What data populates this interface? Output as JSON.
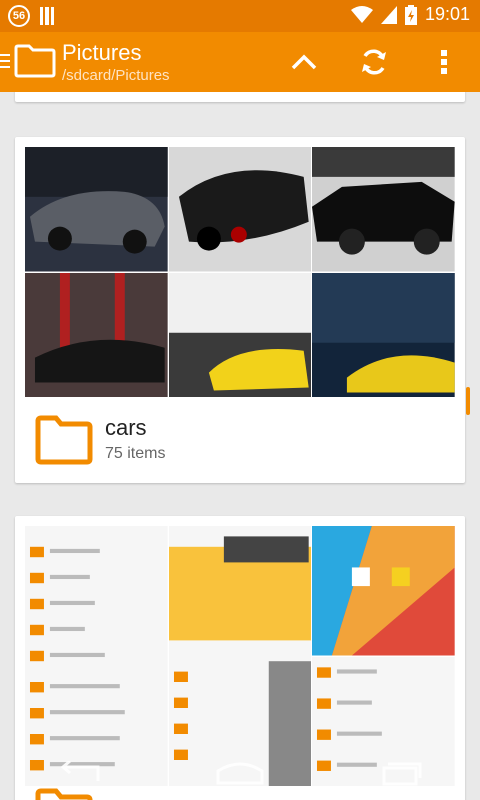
{
  "status_bar": {
    "notification_count": "56",
    "time": "19:01"
  },
  "app_bar": {
    "title": "Pictures",
    "path": "/sdcard/Pictures"
  },
  "folders": [
    {
      "name": "cars",
      "count": "75 items"
    }
  ],
  "colors": {
    "status_bar": "#e57a00",
    "app_bar": "#f28b00",
    "accent": "#f28b00",
    "background": "#e9e9e9"
  },
  "icons": {
    "drawer": "menu-drawer-icon",
    "folder": "folder-icon",
    "up": "chevron-up-icon",
    "refresh": "refresh-icon",
    "overflow": "more-vert-icon"
  }
}
